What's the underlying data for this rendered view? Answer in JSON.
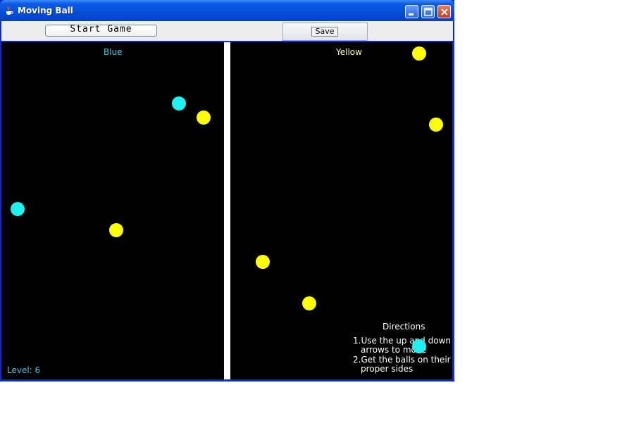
{
  "window": {
    "title": "Moving Ball"
  },
  "toolbar": {
    "start_label": "Start Game",
    "save_label": "Save"
  },
  "game": {
    "blue_side_label": "Blue",
    "yellow_side_label": "Yellow",
    "level_text": "Level: 6",
    "directions": {
      "title": "Directions",
      "line1a": "1.Use the up and down",
      "line1b": "arrows to move",
      "line2a": "2.Get the balls on their",
      "line2b": "proper sides"
    },
    "colors": {
      "blue_ball": "#1ff0f0",
      "yellow_ball": "#ffff00",
      "background": "#000000",
      "divider": "#ffffff"
    }
  }
}
